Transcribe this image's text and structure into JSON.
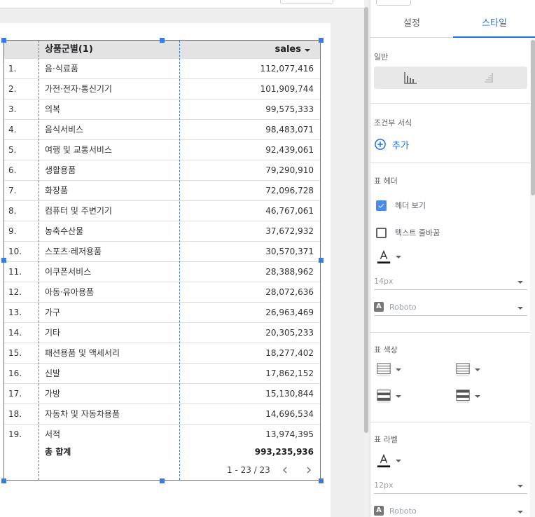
{
  "toolbar": {
    "undo_icon": "undo-icon",
    "edit_icon": "pencil-icon",
    "more_icon": "more-vert-icon"
  },
  "table": {
    "dimension_header": "상품군별(1)",
    "metric_header": "sales",
    "rows": [
      {
        "index": "1.",
        "name": "음·식료품",
        "value": "112,077,416"
      },
      {
        "index": "2.",
        "name": "가전·전자·통신기기",
        "value": "101,909,744"
      },
      {
        "index": "3.",
        "name": "의복",
        "value": "99,575,333"
      },
      {
        "index": "4.",
        "name": "음식서비스",
        "value": "98,483,071"
      },
      {
        "index": "5.",
        "name": "여행 및 교통서비스",
        "value": "92,439,061"
      },
      {
        "index": "6.",
        "name": "생활용품",
        "value": "79,290,910"
      },
      {
        "index": "7.",
        "name": "화장품",
        "value": "72,096,728"
      },
      {
        "index": "8.",
        "name": "컴퓨터 및 주변기기",
        "value": "46,767,061"
      },
      {
        "index": "9.",
        "name": "농축수산물",
        "value": "37,672,932"
      },
      {
        "index": "10.",
        "name": "스포츠·레저용품",
        "value": "30,570,371"
      },
      {
        "index": "11.",
        "name": "이쿠폰서비스",
        "value": "28,388,962"
      },
      {
        "index": "12.",
        "name": "아동·유아용품",
        "value": "28,072,636"
      },
      {
        "index": "13.",
        "name": "가구",
        "value": "26,963,469"
      },
      {
        "index": "14.",
        "name": "기타",
        "value": "20,305,233"
      },
      {
        "index": "15.",
        "name": "패션용품 및 액세서리",
        "value": "18,277,402"
      },
      {
        "index": "16.",
        "name": "신발",
        "value": "17,862,152"
      },
      {
        "index": "17.",
        "name": "가방",
        "value": "15,130,844"
      },
      {
        "index": "18.",
        "name": "자동차 및 자동차용품",
        "value": "14,696,534"
      },
      {
        "index": "19.",
        "name": "서적",
        "value": "13,974,395"
      }
    ],
    "total_label": "총 합계",
    "total_value": "993,235,936",
    "pagination": "1 - 23 / 23"
  },
  "panel": {
    "tabs": [
      "설정",
      "스타일"
    ],
    "active_tab": "스타일",
    "section_general": "일반",
    "section_conditional": "조건부 서식",
    "add_label": "추가",
    "section_header": "표 헤더",
    "show_header_label": "헤더 보기",
    "wrap_text_label": "텍스트 줄바꿈",
    "header_font_size": "14px",
    "header_font_family": "Roboto",
    "section_colors": "표 색상",
    "section_labels": "표 라벨",
    "label_font_size": "12px",
    "label_font_family": "Roboto",
    "accent_color": "#1a73e8"
  }
}
